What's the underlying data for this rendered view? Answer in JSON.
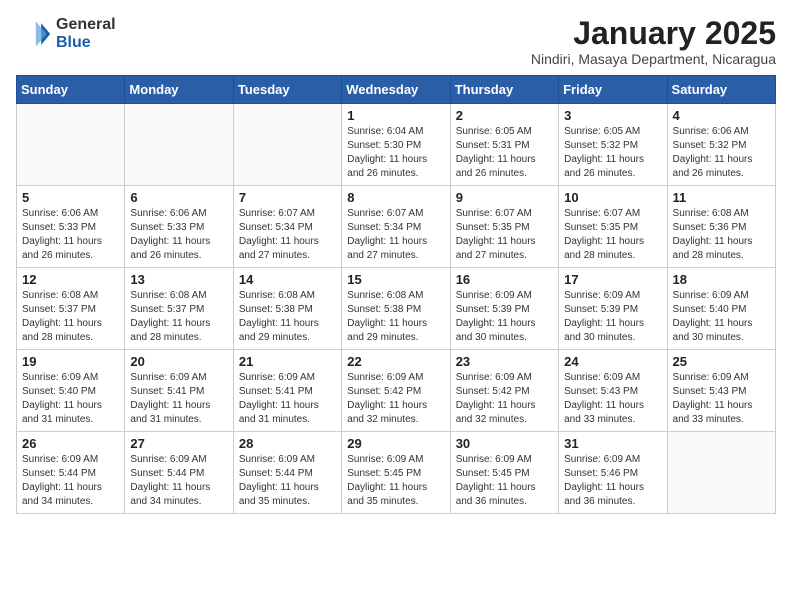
{
  "header": {
    "logo_general": "General",
    "logo_blue": "Blue",
    "month_title": "January 2025",
    "location": "Nindiri, Masaya Department, Nicaragua"
  },
  "days_of_week": [
    "Sunday",
    "Monday",
    "Tuesday",
    "Wednesday",
    "Thursday",
    "Friday",
    "Saturday"
  ],
  "weeks": [
    [
      {
        "day": "",
        "empty": true
      },
      {
        "day": "",
        "empty": true
      },
      {
        "day": "",
        "empty": true
      },
      {
        "day": "1",
        "sunrise": "6:04 AM",
        "sunset": "5:30 PM",
        "daylight": "11 hours and 26 minutes."
      },
      {
        "day": "2",
        "sunrise": "6:05 AM",
        "sunset": "5:31 PM",
        "daylight": "11 hours and 26 minutes."
      },
      {
        "day": "3",
        "sunrise": "6:05 AM",
        "sunset": "5:32 PM",
        "daylight": "11 hours and 26 minutes."
      },
      {
        "day": "4",
        "sunrise": "6:06 AM",
        "sunset": "5:32 PM",
        "daylight": "11 hours and 26 minutes."
      }
    ],
    [
      {
        "day": "5",
        "sunrise": "6:06 AM",
        "sunset": "5:33 PM",
        "daylight": "11 hours and 26 minutes."
      },
      {
        "day": "6",
        "sunrise": "6:06 AM",
        "sunset": "5:33 PM",
        "daylight": "11 hours and 26 minutes."
      },
      {
        "day": "7",
        "sunrise": "6:07 AM",
        "sunset": "5:34 PM",
        "daylight": "11 hours and 27 minutes."
      },
      {
        "day": "8",
        "sunrise": "6:07 AM",
        "sunset": "5:34 PM",
        "daylight": "11 hours and 27 minutes."
      },
      {
        "day": "9",
        "sunrise": "6:07 AM",
        "sunset": "5:35 PM",
        "daylight": "11 hours and 27 minutes."
      },
      {
        "day": "10",
        "sunrise": "6:07 AM",
        "sunset": "5:35 PM",
        "daylight": "11 hours and 28 minutes."
      },
      {
        "day": "11",
        "sunrise": "6:08 AM",
        "sunset": "5:36 PM",
        "daylight": "11 hours and 28 minutes."
      }
    ],
    [
      {
        "day": "12",
        "sunrise": "6:08 AM",
        "sunset": "5:37 PM",
        "daylight": "11 hours and 28 minutes."
      },
      {
        "day": "13",
        "sunrise": "6:08 AM",
        "sunset": "5:37 PM",
        "daylight": "11 hours and 28 minutes."
      },
      {
        "day": "14",
        "sunrise": "6:08 AM",
        "sunset": "5:38 PM",
        "daylight": "11 hours and 29 minutes."
      },
      {
        "day": "15",
        "sunrise": "6:08 AM",
        "sunset": "5:38 PM",
        "daylight": "11 hours and 29 minutes."
      },
      {
        "day": "16",
        "sunrise": "6:09 AM",
        "sunset": "5:39 PM",
        "daylight": "11 hours and 30 minutes."
      },
      {
        "day": "17",
        "sunrise": "6:09 AM",
        "sunset": "5:39 PM",
        "daylight": "11 hours and 30 minutes."
      },
      {
        "day": "18",
        "sunrise": "6:09 AM",
        "sunset": "5:40 PM",
        "daylight": "11 hours and 30 minutes."
      }
    ],
    [
      {
        "day": "19",
        "sunrise": "6:09 AM",
        "sunset": "5:40 PM",
        "daylight": "11 hours and 31 minutes."
      },
      {
        "day": "20",
        "sunrise": "6:09 AM",
        "sunset": "5:41 PM",
        "daylight": "11 hours and 31 minutes."
      },
      {
        "day": "21",
        "sunrise": "6:09 AM",
        "sunset": "5:41 PM",
        "daylight": "11 hours and 31 minutes."
      },
      {
        "day": "22",
        "sunrise": "6:09 AM",
        "sunset": "5:42 PM",
        "daylight": "11 hours and 32 minutes."
      },
      {
        "day": "23",
        "sunrise": "6:09 AM",
        "sunset": "5:42 PM",
        "daylight": "11 hours and 32 minutes."
      },
      {
        "day": "24",
        "sunrise": "6:09 AM",
        "sunset": "5:43 PM",
        "daylight": "11 hours and 33 minutes."
      },
      {
        "day": "25",
        "sunrise": "6:09 AM",
        "sunset": "5:43 PM",
        "daylight": "11 hours and 33 minutes."
      }
    ],
    [
      {
        "day": "26",
        "sunrise": "6:09 AM",
        "sunset": "5:44 PM",
        "daylight": "11 hours and 34 minutes."
      },
      {
        "day": "27",
        "sunrise": "6:09 AM",
        "sunset": "5:44 PM",
        "daylight": "11 hours and 34 minutes."
      },
      {
        "day": "28",
        "sunrise": "6:09 AM",
        "sunset": "5:44 PM",
        "daylight": "11 hours and 35 minutes."
      },
      {
        "day": "29",
        "sunrise": "6:09 AM",
        "sunset": "5:45 PM",
        "daylight": "11 hours and 35 minutes."
      },
      {
        "day": "30",
        "sunrise": "6:09 AM",
        "sunset": "5:45 PM",
        "daylight": "11 hours and 36 minutes."
      },
      {
        "day": "31",
        "sunrise": "6:09 AM",
        "sunset": "5:46 PM",
        "daylight": "11 hours and 36 minutes."
      },
      {
        "day": "",
        "empty": true
      }
    ]
  ],
  "labels": {
    "sunrise_prefix": "Sunrise: ",
    "sunset_prefix": "Sunset: ",
    "daylight_label": "Daylight: "
  }
}
